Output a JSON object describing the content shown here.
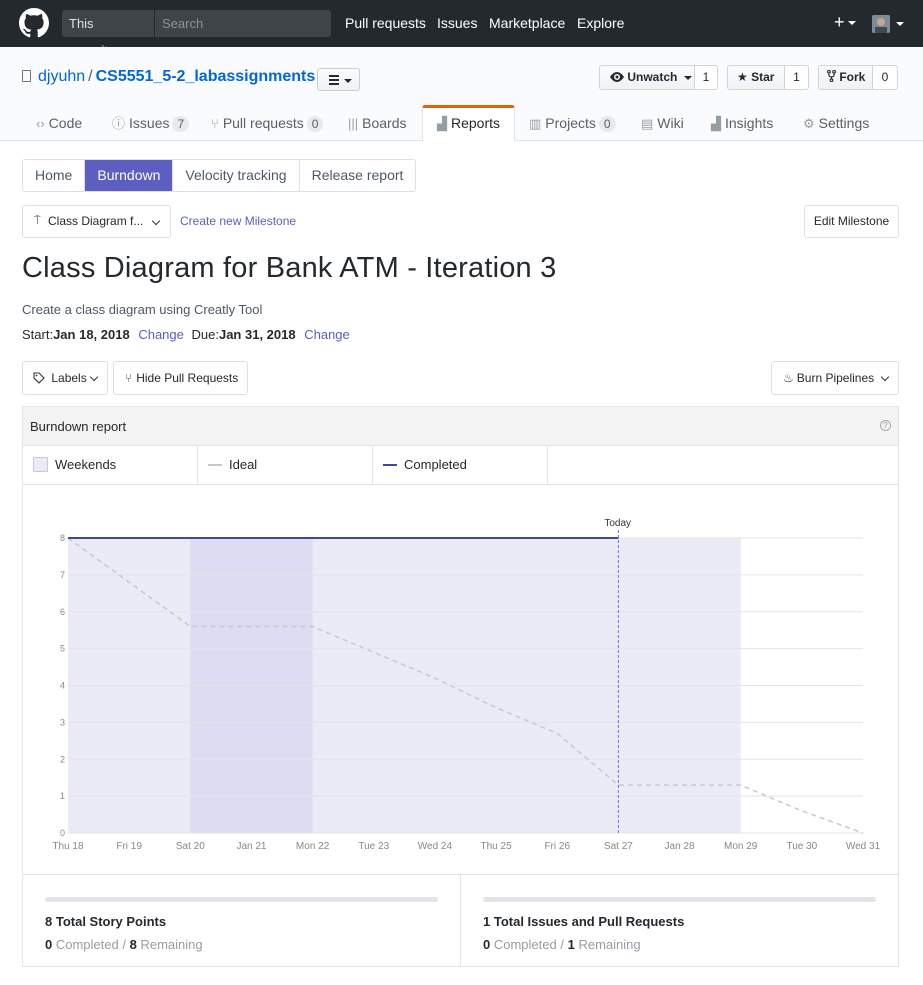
{
  "topbar": {
    "search_scope": "This repository",
    "search_placeholder": "Search",
    "nav": [
      "Pull requests",
      "Issues",
      "Marketplace",
      "Explore"
    ],
    "plus": "+"
  },
  "repo": {
    "owner": "djyuhn",
    "separator": "/",
    "name": "CS5551_5-2_labassignments",
    "unwatch_label": "Unwatch",
    "unwatch_count": "1",
    "star_label": "Star",
    "star_count": "1",
    "fork_label": "Fork",
    "fork_count": "0"
  },
  "tabs": [
    {
      "label": "Code",
      "icon": "code-icon",
      "count": ""
    },
    {
      "label": "Issues",
      "icon": "issue-icon",
      "count": "7"
    },
    {
      "label": "Pull requests",
      "icon": "pull-request-icon",
      "count": "0"
    },
    {
      "label": "Boards",
      "icon": "boards-icon",
      "count": ""
    },
    {
      "label": "Reports",
      "icon": "graph-icon",
      "count": "",
      "selected": true
    },
    {
      "label": "Projects",
      "icon": "project-icon",
      "count": "0"
    },
    {
      "label": "Wiki",
      "icon": "book-icon",
      "count": ""
    },
    {
      "label": "Insights",
      "icon": "graph-icon",
      "count": ""
    },
    {
      "label": "Settings",
      "icon": "gear-icon",
      "count": ""
    }
  ],
  "report_tabs": [
    "Home",
    "Burndown",
    "Velocity tracking",
    "Release report"
  ],
  "report_tab_active": "Burndown",
  "milestone": {
    "select_value": "Class Diagram f...",
    "create_link": "Create new Milestone",
    "edit_button": "Edit Milestone",
    "title": "Class Diagram for Bank ATM - Iteration 3",
    "description": "Create a class diagram using Creatly Tool",
    "start_label": "Start:",
    "start_date": "Jan 18, 2018",
    "due_label": "Due:",
    "due_date": "Jan 31, 2018",
    "change_label": "Change"
  },
  "filters": {
    "labels": "Labels",
    "hide_prs": "Hide Pull Requests",
    "burn_pipelines": "Burn Pipelines"
  },
  "panel": {
    "title": "Burndown report",
    "help": "?",
    "legend": [
      "Weekends",
      "Ideal",
      "Completed"
    ]
  },
  "colors": {
    "accent": "#5c5fbf",
    "completed_line": "#3f47a0",
    "ideal_line": "#c8c8c8",
    "period_fill": "#ebebf8",
    "weekend_fill": "#dcdcf2",
    "topbar": "#24292e",
    "selected_tab": "#e36209"
  },
  "chart_data": {
    "type": "line",
    "categories": [
      "Thu 18",
      "Fri 19",
      "Sat 20",
      "Jan 21",
      "Mon 22",
      "Tue 23",
      "Wed 24",
      "Thu 25",
      "Fri 26",
      "Sat 27",
      "Jan 28",
      "Mon 29",
      "Tue 30",
      "Wed 31"
    ],
    "ylim": [
      0,
      8
    ],
    "yticks": [
      0,
      1,
      2,
      3,
      4,
      5,
      6,
      7,
      8
    ],
    "series": [
      {
        "name": "Ideal",
        "values": [
          8,
          6.8,
          5.6,
          5.6,
          5.6,
          4.9,
          4.2,
          3.4,
          2.7,
          1.3,
          1.3,
          1.3,
          0.6,
          0
        ]
      },
      {
        "name": "Completed",
        "values": [
          8,
          8,
          8,
          8,
          8,
          8,
          8,
          8,
          8,
          8,
          null,
          null,
          null,
          null
        ]
      }
    ],
    "weekend_range": [
      "Sat 20",
      "Mon 22"
    ],
    "shaded_range": [
      "Thu 18",
      "Mon 29"
    ],
    "today_marker": {
      "label": "Today",
      "at": "Sat 27"
    },
    "grid": true
  },
  "summary": {
    "points": {
      "title": "8 Total Story Points",
      "completed": "0",
      "completed_label": "Completed",
      "remaining": "8",
      "remaining_label": "Remaining"
    },
    "issues": {
      "title": "1 Total Issues and Pull Requests",
      "completed": "0",
      "completed_label": "Completed",
      "remaining": "1",
      "remaining_label": "Remaining"
    },
    "slash": "/"
  }
}
